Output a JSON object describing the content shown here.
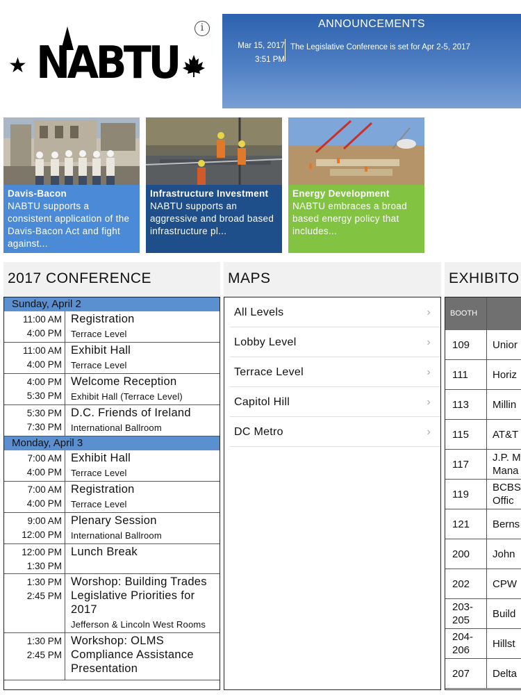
{
  "header": {
    "logo_text": "NABTU",
    "info_label": "i"
  },
  "announcements": {
    "title": "ANNOUNCEMENTS",
    "date": "Mar 15, 2017",
    "time": "3:51 PM",
    "text": "The Legislative Conference is set for Apr 2-5, 2017"
  },
  "tiles": [
    {
      "title": "Davis-Bacon",
      "text": "NABTU supports a consistent application of the Davis-Bacon Act and fight against..."
    },
    {
      "title": "Infrastructure Investment",
      "text": "NABTU supports an aggressive and broad based infrastructure pl..."
    },
    {
      "title": "Energy Development",
      "text": "NABTU embraces a broad based energy policy that includes..."
    }
  ],
  "conference": {
    "title": "2017 CONFERENCE",
    "days": [
      {
        "label": "Sunday, April 2",
        "events": [
          {
            "start": "11:00 AM",
            "end": "4:00 PM",
            "title": "Registration",
            "location": "Terrace Level"
          },
          {
            "start": "11:00 AM",
            "end": "4:00 PM",
            "title": "Exhibit Hall",
            "location": "Terrace Level"
          },
          {
            "start": "4:00 PM",
            "end": "5:30 PM",
            "title": "Welcome Reception",
            "location": "Exhibit Hall (Terrace Level)"
          },
          {
            "start": "5:30 PM",
            "end": "7:30 PM",
            "title": "D.C. Friends of Ireland",
            "location": "International Ballroom"
          }
        ]
      },
      {
        "label": "Monday, April 3",
        "events": [
          {
            "start": "7:00 AM",
            "end": "4:00 PM",
            "title": "Exhibit Hall",
            "location": "Terrace Level"
          },
          {
            "start": "7:00 AM",
            "end": "4:00 PM",
            "title": "Registration",
            "location": "Terrace Level"
          },
          {
            "start": "9:00 AM",
            "end": "12:00 PM",
            "title": "Plenary Session",
            "location": "International Ballroom"
          },
          {
            "start": "12:00 PM",
            "end": "1:30 PM",
            "title": "Lunch Break",
            "location": ""
          },
          {
            "start": "1:30 PM",
            "end": "2:45 PM",
            "title": "Worshop: Building Trades Legislative Priorities for 2017",
            "location": "Jefferson & Lincoln West Rooms"
          },
          {
            "start": "1:30 PM",
            "end": "2:45 PM",
            "title": "Workshop: OLMS Compliance Assistance Presentation",
            "location": ""
          }
        ]
      }
    ]
  },
  "maps": {
    "title": "MAPS",
    "items": [
      "All Levels",
      "Lobby Level",
      "Terrace Level",
      "Capitol Hill",
      "DC Metro"
    ]
  },
  "exhibitors": {
    "title": "EXHIBITO",
    "booth_header": "BOOTH",
    "rows": [
      {
        "booth": "109",
        "name": "Unior"
      },
      {
        "booth": "111",
        "name": "Horiz"
      },
      {
        "booth": "113",
        "name": "Millin"
      },
      {
        "booth": "115",
        "name": "AT&T"
      },
      {
        "booth": "117",
        "name": "J.P. M\nMana"
      },
      {
        "booth": "119",
        "name": "BCBS\nOffic"
      },
      {
        "booth": "121",
        "name": "Berns"
      },
      {
        "booth": "200",
        "name": "John"
      },
      {
        "booth": "202",
        "name": "CPW"
      },
      {
        "booth": "203-\n205",
        "name": "Build"
      },
      {
        "booth": "204-\n206",
        "name": "Hillst"
      },
      {
        "booth": "207",
        "name": "Delta"
      }
    ]
  },
  "colors": {
    "announce_blue": "#2c62ae",
    "tile_light_blue": "#4a8ad6",
    "tile_dark_blue": "#1e4f8a",
    "tile_green": "#82c341",
    "day_header_blue": "#5a8fd0",
    "table_header_gray": "#707070"
  }
}
